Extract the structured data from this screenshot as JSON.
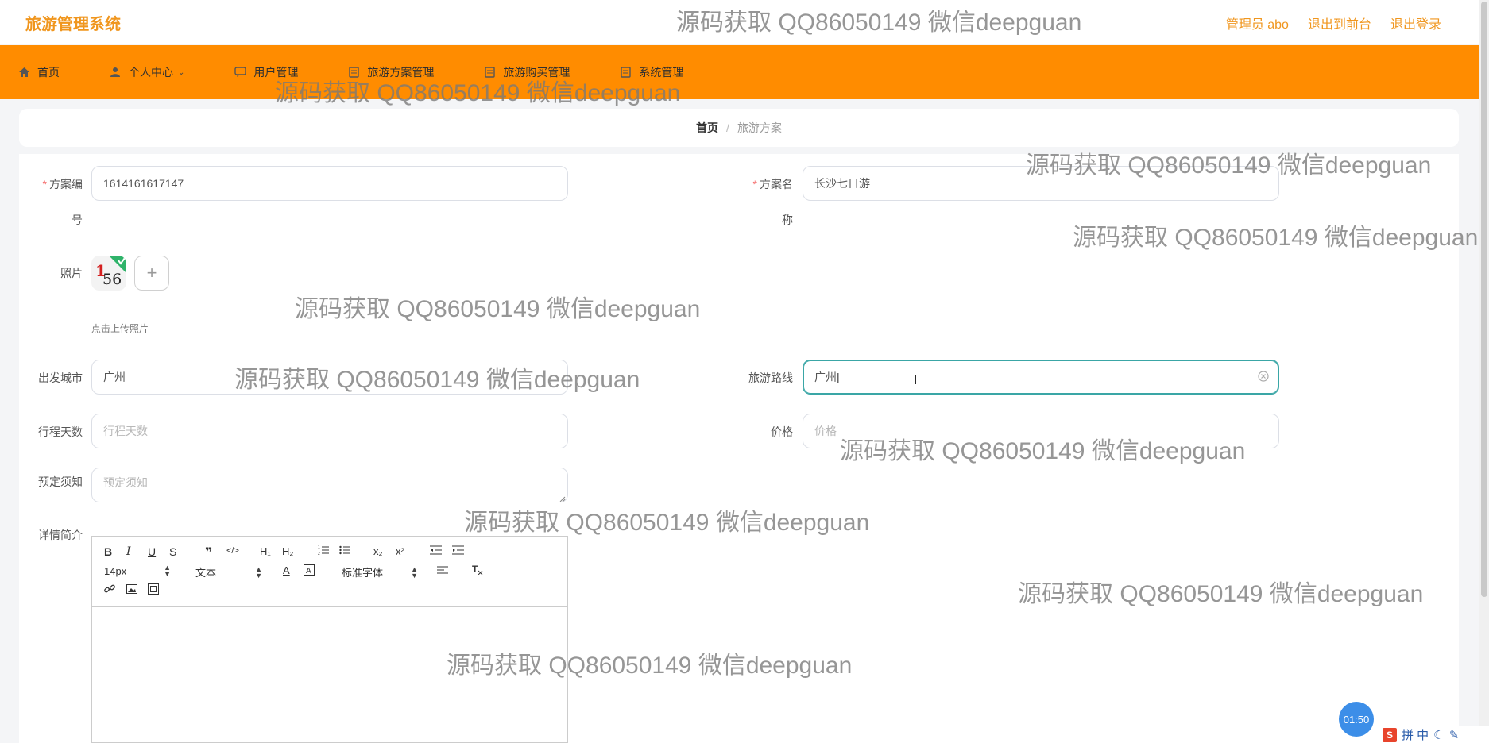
{
  "header": {
    "logo": "旅游管理系统",
    "admin": "管理员 abo",
    "back_front": "退出到前台",
    "logout": "退出登录"
  },
  "nav": [
    {
      "label": "首页",
      "icon": "home-icon"
    },
    {
      "label": "个人中心",
      "icon": "user-icon",
      "has_caret": true
    },
    {
      "label": "用户管理",
      "icon": "chat-icon"
    },
    {
      "label": "旅游方案管理",
      "icon": "doc-icon"
    },
    {
      "label": "旅游购买管理",
      "icon": "doc-icon"
    },
    {
      "label": "系统管理",
      "icon": "doc-icon"
    }
  ],
  "breadcrumb": {
    "home": "首页",
    "separator": "/",
    "current": "旅游方案"
  },
  "form": {
    "plan_no_label_1": "方案编",
    "plan_no_label_2": "号",
    "plan_no_value": "1614161617147",
    "plan_name_label_1": "方案名",
    "plan_name_label_2": "称",
    "plan_name_value": "长沙七日游",
    "photo_label": "照片",
    "photo_hint": "点击上传照片",
    "add_symbol": "+",
    "depart_label": "出发城市",
    "depart_value": "广州",
    "route_label": "旅游路线",
    "route_value": "广州",
    "days_label": "行程天数",
    "days_placeholder": "行程天数",
    "price_label": "价格",
    "price_placeholder": "价格",
    "notice_label": "预定须知",
    "notice_placeholder": "预定须知",
    "detail_label": "详情简介",
    "required_mark": "*"
  },
  "editor": {
    "font_size": "14px",
    "block_type": "文本",
    "font_family": "标准字体",
    "b": "B",
    "i": "I",
    "u": "U",
    "s": "S",
    "h1": "H₁",
    "h2": "H₂",
    "sub": "x₂",
    "sup": "x²"
  },
  "watermark": "源码获取 QQ86050149 微信deepguan",
  "timer": "01:50",
  "ime": {
    "badge": "S",
    "text": "拼 中"
  },
  "colors": {
    "accent": "#ff8c00",
    "logo": "#f0961e",
    "focus": "#3aa6a6",
    "required": "#f56c6c"
  }
}
